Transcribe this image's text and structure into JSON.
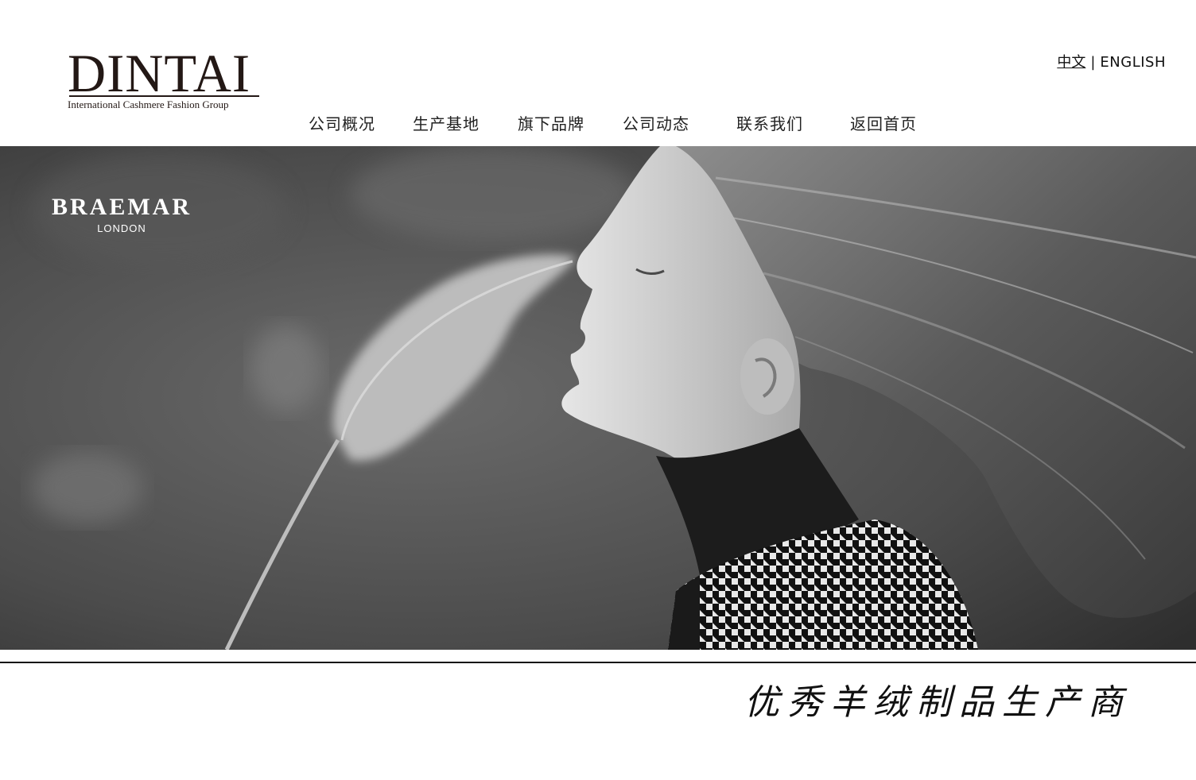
{
  "logo": {
    "word": "DINTAI",
    "tagline": "International Cashmere Fashion Group"
  },
  "language": {
    "chinese": "中文",
    "separator": "|",
    "english": "ENGLISH"
  },
  "nav": {
    "items": [
      {
        "label": "公司概况"
      },
      {
        "label": "生产基地"
      },
      {
        "label": "旗下品牌"
      },
      {
        "label": "公司动态"
      },
      {
        "label": "联系我们"
      },
      {
        "label": "返回首页"
      }
    ]
  },
  "banner": {
    "brand": "BRAEMAR",
    "city": "LONDON"
  },
  "slogan": "优秀羊绒制品生产商",
  "colors": {
    "text": "#231815",
    "banner_bg": "#4a4a4a",
    "divider": "#111111"
  }
}
